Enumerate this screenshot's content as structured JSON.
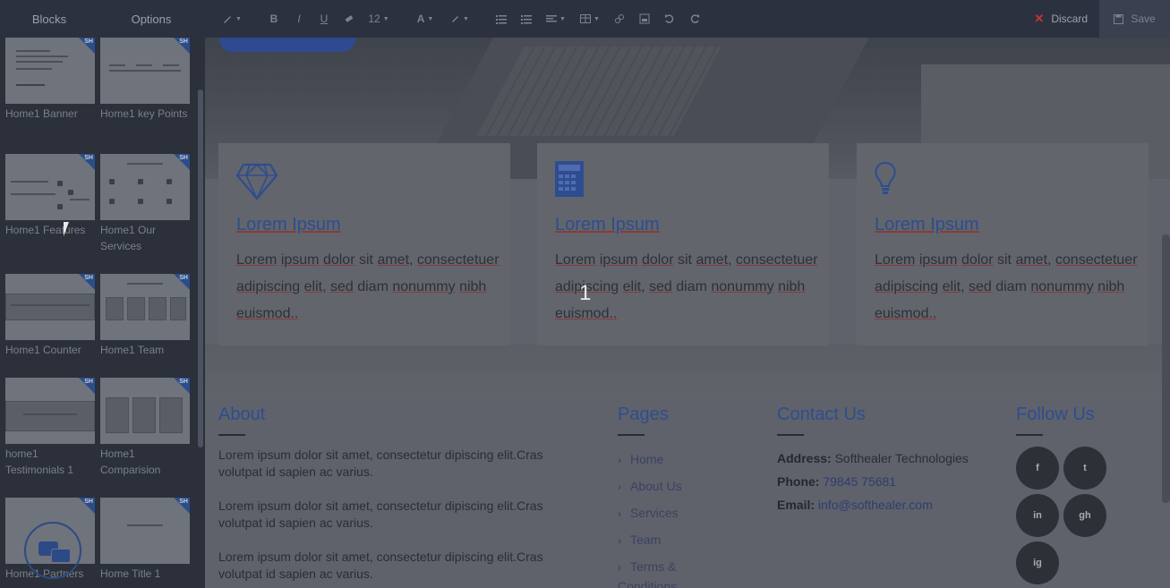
{
  "toolbar": {
    "tabs": [
      "Blocks",
      "Options"
    ],
    "font_size": "12",
    "discard_label": "Discard",
    "save_label": "Save"
  },
  "sidebar": {
    "badge": "SH",
    "blocks": [
      {
        "label": "Home1 Banner"
      },
      {
        "label": "Home1 key Points"
      },
      {
        "label": "Home1 Features"
      },
      {
        "label": "Home1 Our Services"
      },
      {
        "label": "Home1 Counter"
      },
      {
        "label": "Home1 Team"
      },
      {
        "label": "home1 Testimonials 1"
      },
      {
        "label": "Home1 Comparision"
      },
      {
        "label": "Home1 Partners"
      },
      {
        "label": "Home Title 1"
      }
    ]
  },
  "canvas": {
    "page_number": "1",
    "cards": [
      {
        "icon": "diamond-icon",
        "title": "Lorem Ipsum",
        "text": "Lorem ipsum dolor sit amet, consectetuer adipiscing elit, sed diam nonummy nibh euismod.."
      },
      {
        "icon": "calculator-icon",
        "title": "Lorem Ipsum",
        "text": "Lorem ipsum dolor sit amet, consectetuer adipiscing elit, sed diam nonummy nibh euismod.."
      },
      {
        "icon": "lightbulb-icon",
        "title": "Lorem Ipsum",
        "text": "Lorem ipsum dolor sit amet, consectetuer adipiscing elit, sed diam nonummy nibh euismod.."
      }
    ],
    "footer": {
      "about": {
        "title": "About",
        "paragraphs": [
          "Lorem ipsum dolor sit amet, consectetur dipiscing elit.Cras volutpat id sapien ac varius.",
          "Lorem ipsum dolor sit amet, consectetur dipiscing elit.Cras volutpat id sapien ac varius.",
          "Lorem ipsum dolor sit amet, consectetur dipiscing elit.Cras volutpat id sapien ac varius."
        ]
      },
      "pages": {
        "title": "Pages",
        "links": [
          "Home",
          "About Us",
          "Services",
          "Team",
          "Terms & Conditions"
        ]
      },
      "contact": {
        "title": "Contact Us",
        "address_label": "Address:",
        "address": "Softhealer Technologies",
        "phone_label": "Phone:",
        "phone": "79845 75681",
        "email_label": "Email:",
        "email": "info@softhealer.com"
      },
      "follow": {
        "title": "Follow Us",
        "icons": [
          "f",
          "t",
          "in",
          "gh",
          "ig"
        ]
      }
    }
  }
}
